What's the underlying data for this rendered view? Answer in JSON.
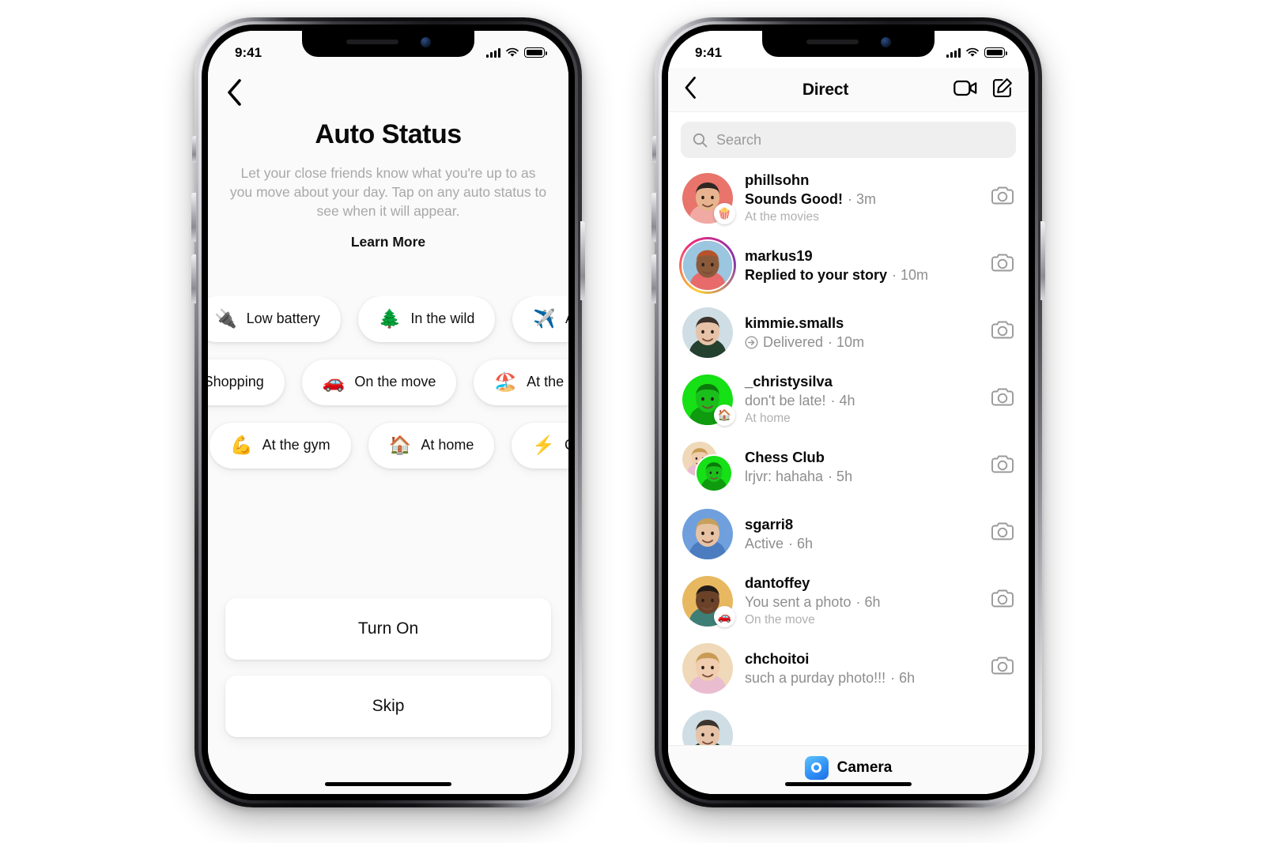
{
  "status_bar": {
    "time": "9:41",
    "cellular": "signal-bars-icon",
    "wifi": "wifi-icon",
    "battery": "battery-full-icon"
  },
  "auto_status": {
    "back_icon": "chevron-left-icon",
    "title": "Auto Status",
    "description": "Let your close friends know what you're up to as you move about your day. Tap on any auto status to see when it will appear.",
    "learn_more": "Learn More",
    "chip_rows": [
      [
        {
          "emoji": "🔌",
          "label": "Low battery",
          "icon_name": "plug-emoji"
        },
        {
          "emoji": "🌲",
          "label": "In the wild",
          "icon_name": "evergreen-tree-emoji"
        },
        {
          "emoji": "✈️",
          "label": "At the airport",
          "icon_name": "airplane-emoji"
        }
      ],
      [
        {
          "emoji": "🛍️",
          "label": "Shopping",
          "icon_name": "shopping-bags-emoji"
        },
        {
          "emoji": "🚗",
          "label": "On the move",
          "icon_name": "car-emoji"
        },
        {
          "emoji": "🏖️",
          "label": "At the beach",
          "icon_name": "beach-emoji"
        }
      ],
      [
        {
          "emoji": "💪",
          "label": "At the gym",
          "icon_name": "flexed-biceps-emoji"
        },
        {
          "emoji": "🏠",
          "label": "At home",
          "icon_name": "house-emoji"
        },
        {
          "emoji": "⚡",
          "label": "Charging",
          "icon_name": "high-voltage-emoji"
        }
      ]
    ],
    "primary_button": "Turn On",
    "secondary_button": "Skip"
  },
  "direct": {
    "back_icon": "chevron-left-icon",
    "title": "Direct",
    "video_icon": "video-camera-icon",
    "compose_icon": "compose-pencil-icon",
    "search": {
      "placeholder": "Search",
      "icon": "search-icon",
      "value": ""
    },
    "row_action_icon": "camera-icon",
    "threads": [
      {
        "name": "phillsohn",
        "preview": "Sounds Good!",
        "time": "3m",
        "unread": true,
        "status": "At the movies",
        "badge": "🍿",
        "badge_name": "popcorn-emoji",
        "ring": false,
        "delivered": false,
        "group": false
      },
      {
        "name": "markus19",
        "preview": "Replied to your story",
        "time": "10m",
        "unread": true,
        "status": "",
        "badge": "",
        "badge_name": "",
        "ring": true,
        "delivered": false,
        "group": false
      },
      {
        "name": "kimmie.smalls",
        "preview": "Delivered",
        "time": "10m",
        "unread": false,
        "status": "",
        "badge": "",
        "badge_name": "",
        "ring": false,
        "delivered": true,
        "group": false
      },
      {
        "name": "_christysilva",
        "preview": "don't be late!",
        "time": "4h",
        "unread": false,
        "status": "At home",
        "badge": "🏠",
        "badge_name": "house-emoji",
        "ring": false,
        "delivered": false,
        "group": false
      },
      {
        "name": "Chess Club",
        "preview": "lrjvr: hahaha",
        "time": "5h",
        "unread": false,
        "status": "",
        "badge": "",
        "badge_name": "",
        "ring": false,
        "delivered": false,
        "group": true
      },
      {
        "name": "sgarri8",
        "preview": "Active",
        "time": "6h",
        "unread": false,
        "status": "",
        "badge": "",
        "badge_name": "",
        "ring": false,
        "delivered": false,
        "group": false
      },
      {
        "name": "dantoffey",
        "preview": "You sent a photo",
        "time": "6h",
        "unread": false,
        "status": "On the move",
        "badge": "🚗",
        "badge_name": "car-emoji",
        "ring": false,
        "delivered": false,
        "group": false
      },
      {
        "name": "chchoitoi",
        "preview": "such a purday photo!!!",
        "time": "6h",
        "unread": false,
        "status": "",
        "badge": "",
        "badge_name": "",
        "ring": false,
        "delivered": false,
        "group": false
      }
    ],
    "footer": {
      "label": "Camera",
      "icon": "camera-icon",
      "accent": "#2e8ef7"
    }
  },
  "colors": {
    "screen_bg_left": "#fafafa",
    "screen_bg_right": "#ffffff",
    "muted_text": "#8e8e8e",
    "faint_text": "#b0b0b0",
    "search_bg": "#efefef",
    "accent_blue": "#2e8ef7"
  }
}
